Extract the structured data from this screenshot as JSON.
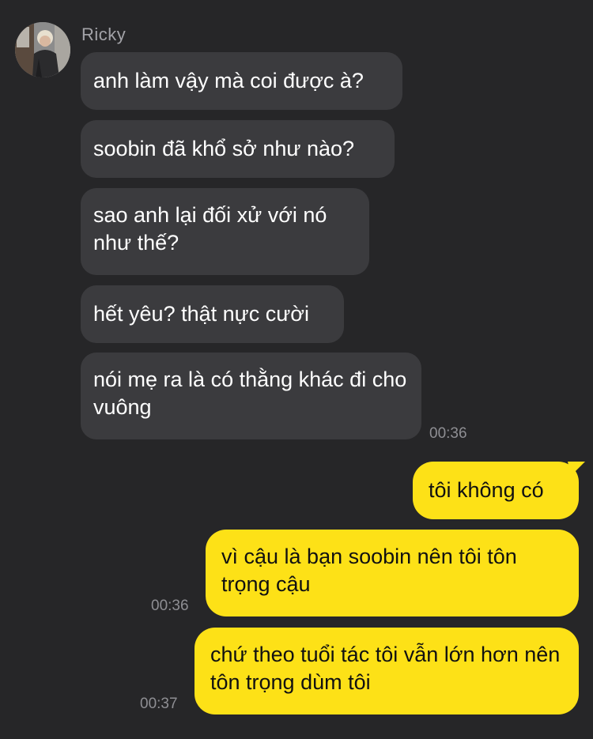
{
  "chat": {
    "sender_name": "Ricky",
    "incoming": [
      "anh làm vậy mà coi được à?",
      "soobin đã khổ sở như nào?",
      "sao anh lại đối xử với nó như thế?",
      "hết yêu? thật nực cười",
      "nói mẹ ra là có thằng khác đi cho vuông"
    ],
    "incoming_time": "00:36",
    "outgoing": [
      {
        "text": "tôi không có",
        "time": ""
      },
      {
        "text": "vì cậu là bạn soobin nên tôi tôn trọng cậu",
        "time": "00:36"
      },
      {
        "text": "chứ theo tuổi tác tôi vẫn lớn hơn nên tôn trọng dùm tôi",
        "time": "00:37"
      }
    ]
  },
  "colors": {
    "background": "#262628",
    "incoming_bubble": "#3b3b3e",
    "outgoing_bubble": "#fde117",
    "timestamp": "#8e8e93"
  }
}
